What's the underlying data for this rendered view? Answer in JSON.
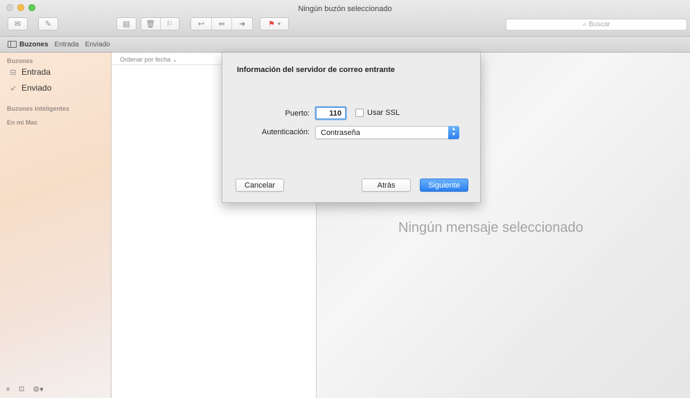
{
  "window": {
    "title": "Ningún buzón seleccionado"
  },
  "toolbar": {
    "search_placeholder": "Buscar",
    "get_mail_icon": "envelope-icon",
    "compose_icon": "compose-icon",
    "archive_icon": "archive-icon",
    "trash_icon": "trash-icon",
    "junk_icon": "junk-icon",
    "reply_icon": "reply-icon",
    "reply_all_icon": "reply-all-icon",
    "forward_icon": "forward-icon",
    "flag_icon": "flag-icon"
  },
  "favorites_bar": {
    "toggle_label": "Buzones",
    "items": [
      "Entrada",
      "Enviado"
    ]
  },
  "sidebar": {
    "mailboxes_header": "Buzones",
    "items": [
      {
        "label": "Entrada",
        "icon": "inbox-icon"
      },
      {
        "label": "Enviado",
        "icon": "sent-icon"
      }
    ],
    "smart_header": "Buzones inteligentes",
    "on_mac_header": "En mi Mac",
    "footer_icons": [
      "add-icon",
      "mailbox-icon",
      "gear-icon"
    ]
  },
  "message_list": {
    "sort_label": "Ordenar por fecha"
  },
  "preview": {
    "empty_text": "Ningún mensaje seleccionado"
  },
  "dialog": {
    "title": "Información del servidor de correo entrante",
    "port_label": "Puerto:",
    "port_value": "110",
    "ssl_label": "Usar SSL",
    "ssl_checked": false,
    "auth_label": "Autenticación:",
    "auth_value": "Contraseña",
    "cancel_label": "Cancelar",
    "back_label": "Atrás",
    "next_label": "Siguiente"
  },
  "colors": {
    "accent": "#2b7ff1",
    "sidebar_bg": "#f6ddc8"
  }
}
